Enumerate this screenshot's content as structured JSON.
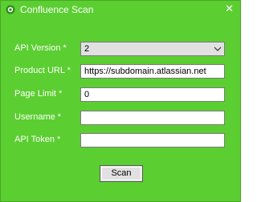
{
  "window": {
    "title": "Confluence Scan",
    "close_glyph": "✕",
    "icon": "app-logo-icon",
    "background": "#5bce31"
  },
  "form": {
    "api_version": {
      "label": "API Version *",
      "value": "2"
    },
    "product_url": {
      "label": "Product URL *",
      "value": "https://subdomain.atlassian.net"
    },
    "page_limit": {
      "label": "Page Limit *",
      "value": "0"
    },
    "username": {
      "label": "Username *",
      "value": ""
    },
    "api_token": {
      "label": "API Token *",
      "value": ""
    }
  },
  "actions": {
    "scan_label": "Scan"
  }
}
